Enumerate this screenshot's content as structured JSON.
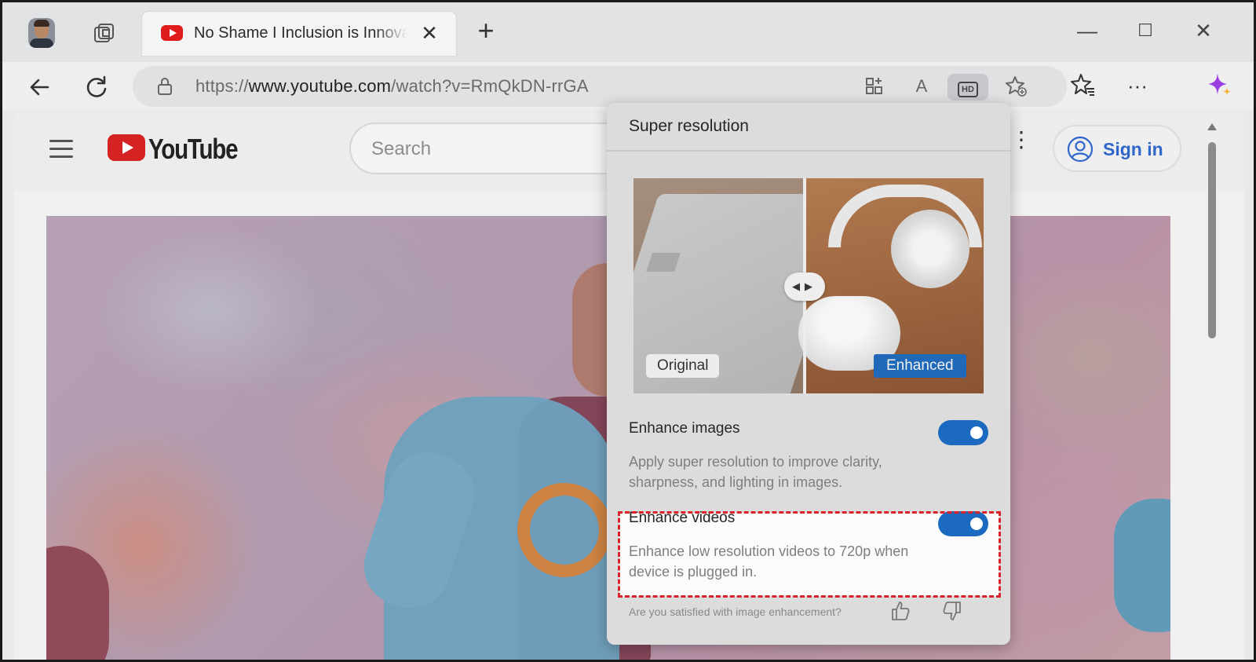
{
  "browser": {
    "tab": {
      "title": "No Shame I Inclusion is Innovation",
      "close_glyph": "✕"
    },
    "new_tab_glyph": "+",
    "window_controls": {
      "minimize": "—",
      "maximize": "☐",
      "close": "✕"
    },
    "address": {
      "scheme": "https://",
      "host": "www.youtube.com",
      "path": "/watch?v=RmQkDN-rrGA"
    },
    "icons": [
      "workspaces-icon",
      "back-icon",
      "refresh-icon",
      "lock-icon",
      "split-screen-icon",
      "read-aloud-icon",
      "hd-icon",
      "add-favorite-icon",
      "favorites-icon",
      "more-icon",
      "copilot-icon"
    ],
    "hd_label": "HD",
    "read_aloud_label": "A",
    "more_glyph": "···"
  },
  "youtube": {
    "logo_text": "YouTube",
    "search_placeholder": "Search",
    "signin_label": "Sign in",
    "more_glyph": "⋮"
  },
  "popup": {
    "title": "Super resolution",
    "preview": {
      "original_label": "Original",
      "enhanced_label": "Enhanced",
      "handle_glyph": "◀▶"
    },
    "enhance_images": {
      "title": "Enhance images",
      "description": "Apply super resolution to improve clarity, sharpness, and lighting in images.",
      "enabled": true
    },
    "enhance_videos": {
      "title": "Enhance videos",
      "description": "Enhance low resolution videos to 720p when device is plugged in.",
      "enabled": true
    },
    "feedback_prompt": "Are you satisfied with image enhancement?"
  },
  "colors": {
    "accent": "#1b6ac0",
    "youtube_red": "#e01b1b",
    "highlight": "#d8232a",
    "signin_text": "#2f66c9"
  }
}
